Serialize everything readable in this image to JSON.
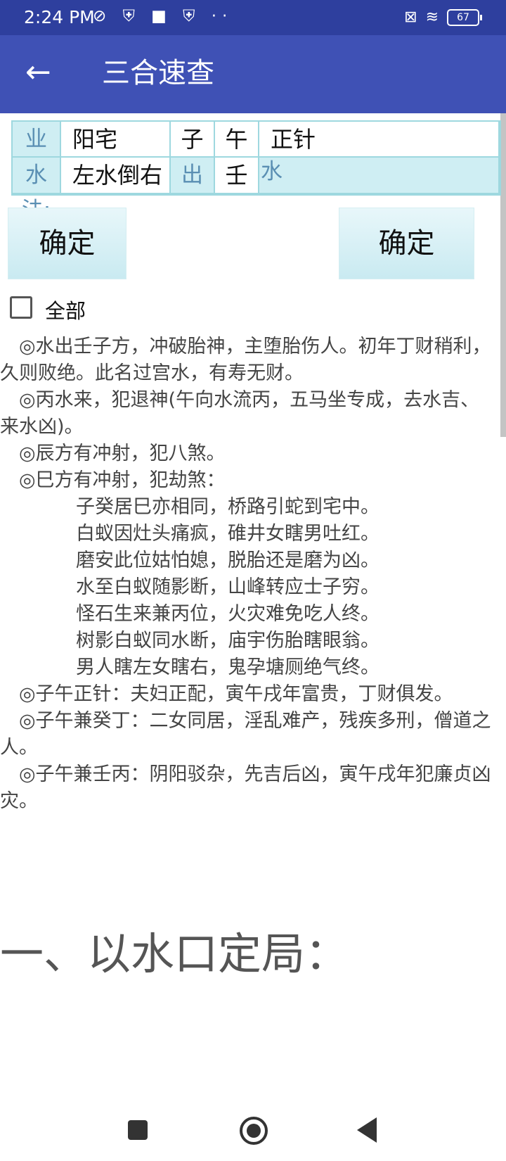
{
  "status_bar": {
    "time": "2:24 PM",
    "left_icons": "⊘ ⛨ ■ ⛨ ··",
    "battery": "67"
  },
  "app_bar": {
    "back_icon": "←",
    "title": "三合速查"
  },
  "form": {
    "row1": {
      "label": "业务:",
      "v1": "阳宅",
      "v2": "子",
      "v3": "午",
      "v4": "正针"
    },
    "row2": {
      "label": "水法:",
      "v1": "左水倒右",
      "v2": "出",
      "v3": "壬",
      "v4": "水"
    }
  },
  "buttons": {
    "confirm_left": "确定",
    "confirm_right": "确定"
  },
  "checkbox": {
    "label": "全部",
    "checked": false
  },
  "content": {
    "lines": [
      "　◎水出壬子方，冲破胎神，主堕胎伤人。初年丁财稍利，",
      "久则败绝。此名过宫水，有寿无财。",
      "　◎丙水来，犯退神(午向水流丙，五马坐专成，去水吉、",
      "来水凶)。",
      "　◎辰方有冲射，犯八煞。",
      "　◎巳方有冲射，犯劫煞：",
      "　　　　子癸居巳亦相同，桥路引蛇到宅中。",
      "　　　　白蚁因灶头痛疯，碓井女瞎男吐红。",
      "　　　　磨安此位姑怕媳，脱胎还是磨为凶。",
      "　　　　水至白蚁随影断，山峰转应士子穷。",
      "　　　　怪石生来兼丙位，火灾难免吃人终。",
      "　　　　树影白蚁同水断，庙宇伤胎瞎眼翁。",
      "　　　　男人瞎左女瞎右，鬼孕塘厕绝气终。",
      "　◎子午正针：夫妇正配，寅午戌年富贵，丁财俱发。",
      "　◎子午兼癸丁：二女同居，淫乱难产，残疾多刑，僧道之",
      "人。",
      "　◎子午兼壬丙：阴阳驳杂，先吉后凶，寅午戌年犯廉贞凶",
      "灾。"
    ],
    "heading": "一、以水口定局："
  }
}
